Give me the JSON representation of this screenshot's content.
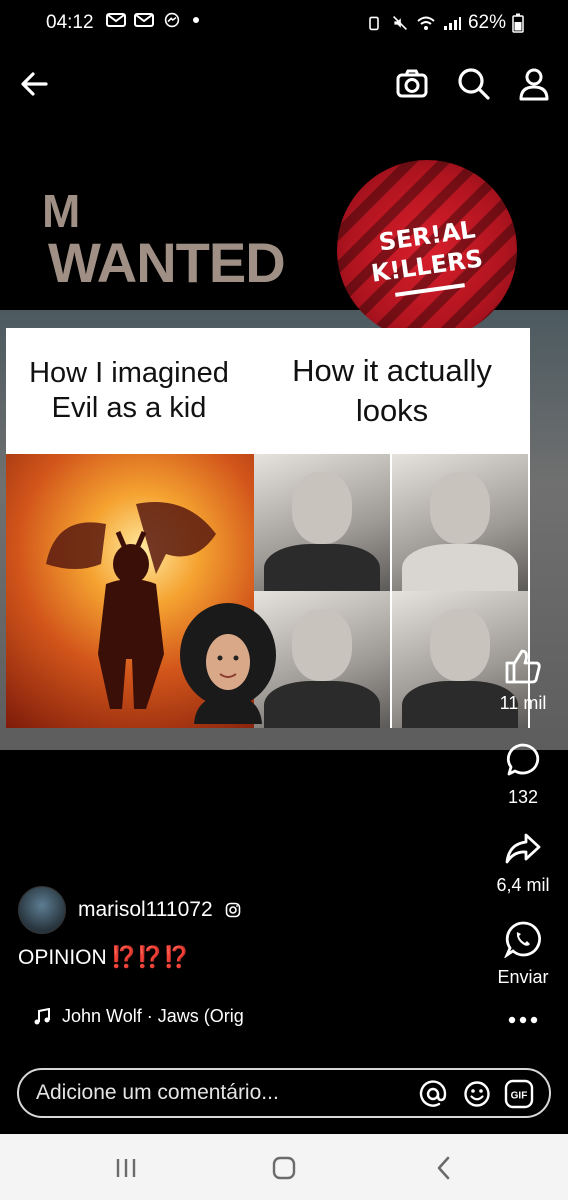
{
  "status_bar": {
    "time": "04:12",
    "battery": "62%"
  },
  "media": {
    "wanted_small": "M",
    "wanted_big": "WANTED",
    "badge_line1": "SER!AL",
    "badge_line2": "K!LLERS",
    "meme_caption_left": "How I imagined Evil as a kid",
    "meme_caption_right": "How it actually looks"
  },
  "actions": {
    "likes": "11 mil",
    "comments": "132",
    "shares": "6,4 mil",
    "send": "Enviar"
  },
  "post": {
    "username": "marisol111072",
    "caption": "OPINION",
    "caption_marks": "⁉️⁉️⁉️",
    "audio": "John Wolf · Jaws (Orig"
  },
  "comment_box": {
    "placeholder": "Adicione um comentário..."
  },
  "colors": {
    "background": "#000000",
    "badge_red": "#d91f2c",
    "navbar": "#f4f4f4",
    "accent_marks": "#e0242e"
  }
}
